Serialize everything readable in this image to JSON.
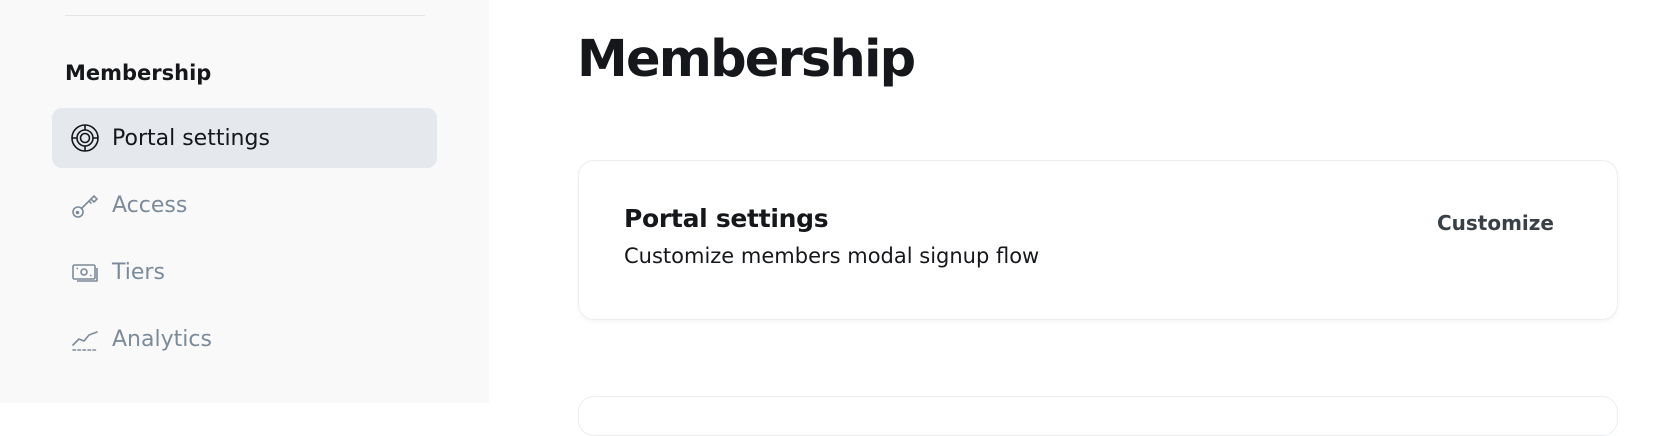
{
  "sidebar": {
    "section_title": "Membership",
    "items": [
      {
        "label": "Portal settings",
        "icon": "portal-icon",
        "active": true
      },
      {
        "label": "Access",
        "icon": "key-icon",
        "active": false
      },
      {
        "label": "Tiers",
        "icon": "money-icon",
        "active": false
      },
      {
        "label": "Analytics",
        "icon": "analytics-chart-icon",
        "active": false
      }
    ]
  },
  "main": {
    "title": "Membership",
    "portal_card": {
      "title": "Portal settings",
      "description": "Customize members modal signup flow",
      "action_label": "Customize"
    }
  },
  "colors": {
    "sidebar_bg": "#f9f9fa",
    "active_item_bg": "#e5e8ec",
    "muted_text": "#7c8b9a",
    "primary_text": "#15171a"
  }
}
